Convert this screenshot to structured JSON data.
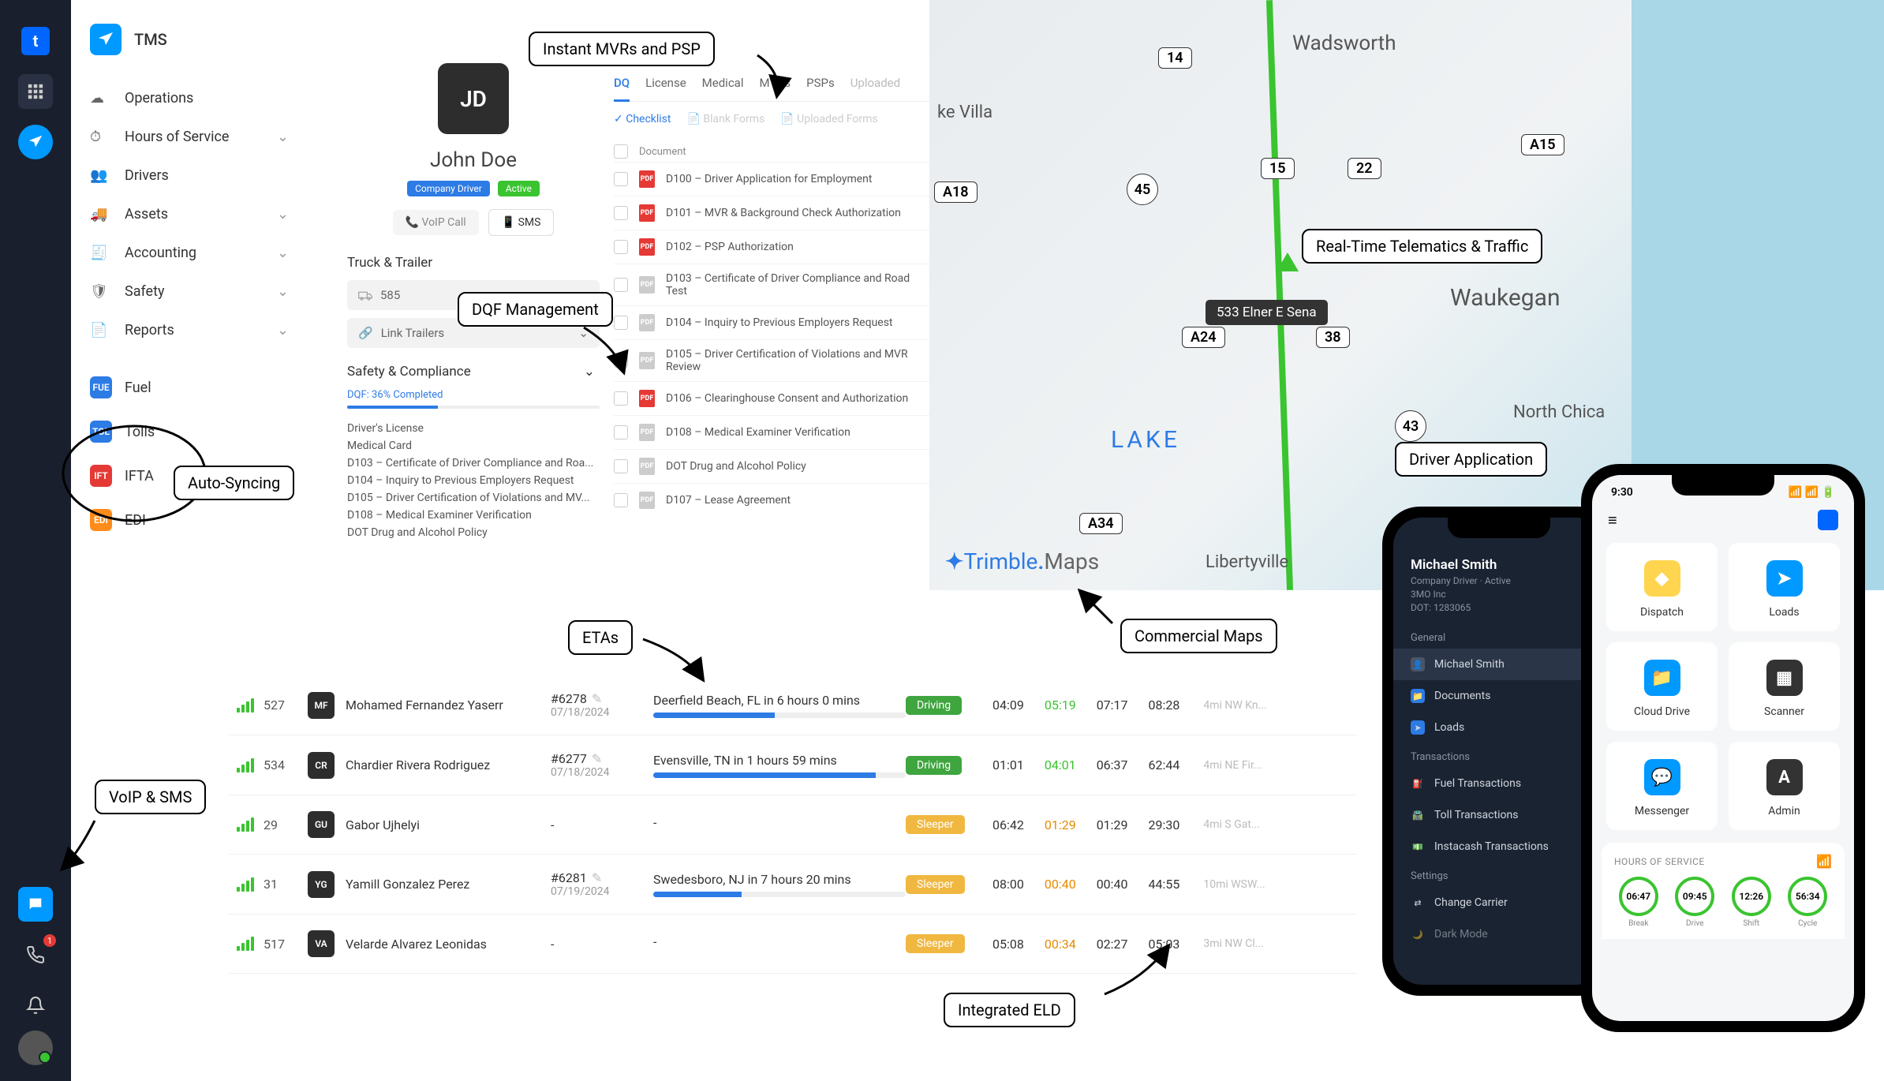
{
  "rail": {
    "badge": "1"
  },
  "sidebar": {
    "title": "TMS",
    "items": [
      {
        "label": "Operations",
        "chevron": false
      },
      {
        "label": "Hours of Service",
        "chevron": true
      },
      {
        "label": "Drivers",
        "chevron": false
      },
      {
        "label": "Assets",
        "chevron": true
      },
      {
        "label": "Accounting",
        "chevron": true
      },
      {
        "label": "Safety",
        "chevron": true
      },
      {
        "label": "Reports",
        "chevron": true
      }
    ],
    "integrations": [
      {
        "label": "Fuel",
        "color": "#2d7be5"
      },
      {
        "label": "Tolls",
        "color": "#2d7be5"
      },
      {
        "label": "IFTA",
        "color": "#e53935"
      },
      {
        "label": "EDI",
        "color": "#ff8c1a"
      }
    ]
  },
  "driver": {
    "initials": "JD",
    "name": "John Doe",
    "badge1": "Company Driver",
    "badge2": "Active",
    "voip": "VoIP Call",
    "sms": "SMS",
    "truck_section": "Truck & Trailer",
    "truck": "585",
    "trailer": "Link Trailers",
    "safety_section": "Safety & Compliance",
    "dqf": "DQF: 36% Completed",
    "items": [
      "Driver's License",
      "Medical Card",
      "D103 – Certificate of Driver Compliance and Roa...",
      "D104 – Inquiry to Previous Employers Request",
      "D105 – Driver Certification of Violations and MV...",
      "D108 – Medical Examiner Verification",
      "DOT Drug and Alcohol Policy"
    ]
  },
  "dqf": {
    "tabs": [
      "DQ",
      "License",
      "Medical",
      "MVRs",
      "PSPs",
      "Uploaded"
    ],
    "toolbar": [
      "Checklist",
      "Blank Forms",
      "Uploaded Forms"
    ],
    "header": "Document",
    "docs": [
      {
        "name": "D100 – Driver Application for Employment",
        "red": true
      },
      {
        "name": "D101 – MVR & Background Check Authorization",
        "red": true
      },
      {
        "name": "D102 – PSP Authorization",
        "red": true
      },
      {
        "name": "D103 – Certificate of Driver Compliance and Road Test",
        "red": false
      },
      {
        "name": "D104 – Inquiry to Previous Employers Request",
        "red": false
      },
      {
        "name": "D105 – Driver Certification of Violations and MVR Review",
        "red": false
      },
      {
        "name": "D106 – Clearinghouse Consent and Authorization",
        "red": true
      },
      {
        "name": "D108 – Medical Examiner Verification",
        "red": false
      },
      {
        "name": "DOT Drug and Alcohol Policy",
        "red": false
      },
      {
        "name": "D107 – Lease Agreement",
        "red": false
      }
    ]
  },
  "map": {
    "marker": "533 Elner E Sena",
    "cities": [
      "ke Villa",
      "Wadsworth",
      "Waukegan",
      "LAKE",
      "Libertyville",
      "North Chica"
    ],
    "shields": [
      "A18",
      "45",
      "14",
      "15",
      "22",
      "A15",
      "A24",
      "38",
      "43",
      "A34"
    ],
    "logo1": "Trimble",
    "logo2": "Maps"
  },
  "dispatch": [
    {
      "truck": "527",
      "ini": "MF",
      "name": "Mohamed Fernandez Yaserr",
      "load": "#6278",
      "date": "07/18/2024",
      "eta": "Deerfield Beach, FL in 6 hours 0 mins",
      "pct": 48,
      "status": "Driving",
      "sc": "driving",
      "t1": "04:09",
      "t2": "05:19",
      "t2c": "good",
      "t3": "07:17",
      "t4": "08:28",
      "note": "4mi NW Kn..."
    },
    {
      "truck": "534",
      "ini": "CR",
      "name": "Chardier Rivera Rodriguez",
      "load": "#6277",
      "date": "07/18/2024",
      "eta": "Evensville, TN in 1 hours 59 mins",
      "pct": 88,
      "status": "Driving",
      "sc": "driving",
      "t1": "01:01",
      "t2": "04:01",
      "t2c": "good",
      "t3": "06:37",
      "t4": "62:44",
      "note": "4mi NE Fir..."
    },
    {
      "truck": "29",
      "ini": "GU",
      "name": "Gabor Ujhelyi",
      "load": "-",
      "date": "",
      "eta": "-",
      "pct": 0,
      "status": "Sleeper",
      "sc": "sleeper",
      "t1": "06:42",
      "t2": "01:29",
      "t2c": "warn",
      "t3": "01:29",
      "t4": "29:30",
      "note": "4mi S Gat..."
    },
    {
      "truck": "31",
      "ini": "YG",
      "name": "Yamill Gonzalez Perez",
      "load": "#6281",
      "date": "07/19/2024",
      "eta": "Swedesboro, NJ in 7 hours 20 mins",
      "pct": 35,
      "status": "Sleeper",
      "sc": "sleeper",
      "t1": "08:00",
      "t2": "00:40",
      "t2c": "warn",
      "t3": "00:40",
      "t4": "44:55",
      "note": "10mi WSW..."
    },
    {
      "truck": "517",
      "ini": "VA",
      "name": "Velarde Alvarez Leonidas",
      "load": "-",
      "date": "",
      "eta": "-",
      "pct": 0,
      "status": "Sleeper",
      "sc": "sleeper",
      "t1": "05:08",
      "t2": "00:34",
      "t2c": "warn",
      "t3": "02:27",
      "t4": "05:03",
      "note": "3mi NW Cl..."
    }
  ],
  "phone_dark": {
    "name": "Michael Smith",
    "sub1": "Company Driver · Active",
    "sub2": "3MO Inc",
    "sub3": "DOT: 1283065",
    "s1": "General",
    "items1": [
      "Michael Smith",
      "Documents",
      "Loads"
    ],
    "s2": "Transactions",
    "items2": [
      "Fuel Transactions",
      "Toll Transactions",
      "Instacash Transactions"
    ],
    "s3": "Settings",
    "items3": [
      "Change Carrier",
      "Dark Mode"
    ]
  },
  "phone_light": {
    "time": "9:30",
    "tiles": [
      "Dispatch",
      "Loads",
      "Cloud Drive",
      "Scanner",
      "Messenger",
      "Admin"
    ],
    "hos_title": "HOURS OF SERVICE",
    "dials": [
      {
        "v": "06:47",
        "l": "Break"
      },
      {
        "v": "09:45",
        "l": "Drive"
      },
      {
        "v": "12:26",
        "l": "Shift"
      },
      {
        "v": "56:34",
        "l": "Cycle"
      }
    ]
  },
  "callouts": {
    "mvr": "Instant MVRs and PSP",
    "dqf": "DQF Management",
    "autosync": "Auto-Syncing",
    "voip": "VoIP & SMS",
    "etas": "ETAs",
    "telematics": "Real-Time Telematics & Traffic",
    "driverapp": "Driver Application",
    "maps": "Commercial Maps",
    "eld": "Integrated ELD"
  }
}
